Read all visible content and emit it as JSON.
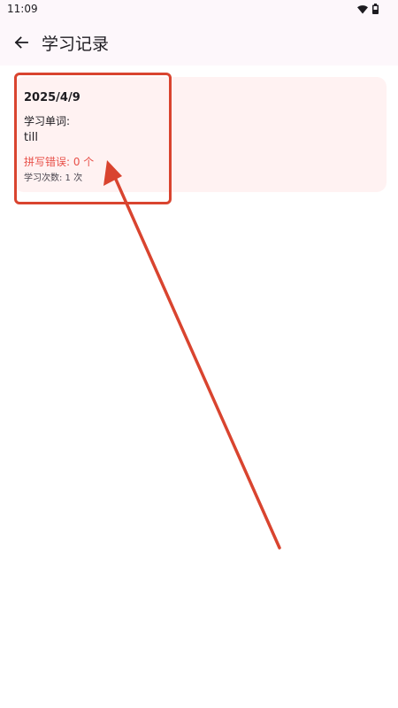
{
  "status_bar": {
    "time": "11:09",
    "icons": [
      "wifi-icon",
      "battery-icon"
    ]
  },
  "app_bar": {
    "back_icon": "arrow-back-icon",
    "title": "学习记录"
  },
  "records": [
    {
      "date": "2025/4/9",
      "words_label": "学习单词:",
      "word": "till",
      "errors": "拼写错误: 0 个",
      "study_count": "学习次数: 1 次"
    }
  ],
  "colors": {
    "background": "#ffffff",
    "app_bar": "#fdf7fb",
    "card": "#fff2f2",
    "error_text": "#e8514a",
    "annotation": "#d9442f"
  }
}
